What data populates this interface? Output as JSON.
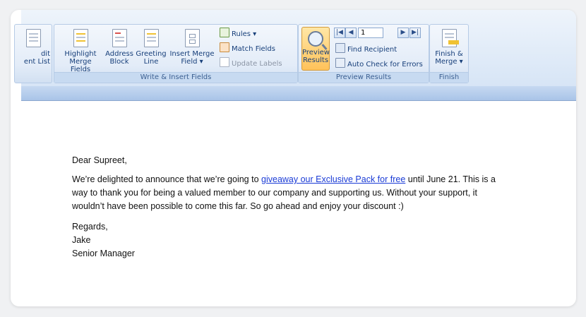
{
  "ribbon": {
    "partial_button": {
      "line1": "dit",
      "line2": "ent List"
    },
    "write_insert": {
      "label": "Write & Insert Fields",
      "buttons": [
        {
          "line1": "Highlight",
          "line2": "Merge Fields"
        },
        {
          "line1": "Address",
          "line2": "Block"
        },
        {
          "line1": "Greeting",
          "line2": "Line"
        },
        {
          "line1": "Insert Merge",
          "line2": "Field ▾"
        }
      ],
      "small": {
        "rules": "Rules ▾",
        "match": "Match Fields",
        "update": "Update Labels"
      }
    },
    "preview_results": {
      "label": "Preview Results",
      "preview_button": {
        "line1": "Preview",
        "line2": "Results"
      },
      "record_value": "1",
      "nav": {
        "first": "|◀",
        "prev": "◀",
        "next": "▶",
        "last": "▶|"
      },
      "find_recipient": "Find Recipient",
      "auto_check": "Auto Check for Errors"
    },
    "finish": {
      "label": "Finish",
      "button": {
        "line1": "Finish &",
        "line2": "Merge ▾"
      }
    }
  },
  "document": {
    "greeting": "Dear Supreet,",
    "body_before": "We’re delighted to announce that we’re going to ",
    "link": "giveaway our Exclusive Pack for free",
    "body_after": " until June 21. This is a  way to thank you for being a valued member to our company and supporting us. Without your support, it wouldn’t have been possible to come this far. So go ahead and enjoy your discount :)",
    "closing": "Regards,",
    "signer": "Jake",
    "title": "Senior Manager"
  }
}
